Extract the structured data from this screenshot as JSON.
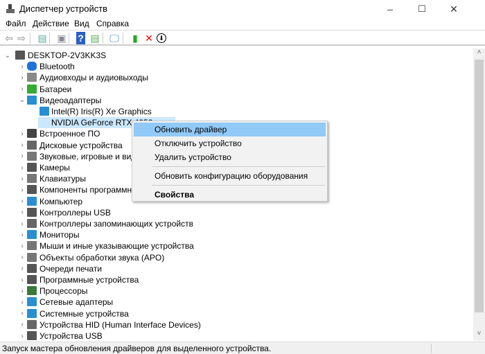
{
  "window": {
    "title": "Диспетчер устройств",
    "min": "–",
    "max": "☐",
    "close": "✕"
  },
  "menu": [
    "Файл",
    "Действие",
    "Вид",
    "Справка"
  ],
  "toolbar": [
    {
      "name": "back-icon",
      "glyph": "⇦",
      "color": "#888"
    },
    {
      "name": "forward-icon",
      "glyph": "⇨",
      "color": "#888"
    },
    {
      "name": "show-hide-console-icon",
      "glyph": "▤",
      "color": "#5a9"
    },
    {
      "name": "properties-icon",
      "glyph": "▣",
      "color": "#889"
    },
    {
      "name": "help-icon",
      "glyph": "?",
      "color": "#fff"
    },
    {
      "name": "action-pane-icon",
      "glyph": "▤",
      "color": "#5a5"
    },
    {
      "name": "scan-hardware-icon",
      "glyph": "🖵",
      "color": "#2a8fd0"
    },
    {
      "name": "update-driver-icon",
      "glyph": "▮",
      "color": "#2a2"
    },
    {
      "name": "uninstall-icon",
      "glyph": "✕",
      "color": "#e00"
    },
    {
      "name": "disable-icon",
      "glyph": "⬇",
      "color": "#000"
    }
  ],
  "tree": [
    {
      "label": "DESKTOP-2V3KK3S",
      "level": 0,
      "chev": "⌄",
      "icon": "computer-icon",
      "color": "#555"
    },
    {
      "label": "Bluetooth",
      "level": 1,
      "chev": "›",
      "icon": "bluetooth-icon",
      "color": "#1e73d8"
    },
    {
      "label": "Аудиовходы и аудиовыходы",
      "level": 1,
      "chev": "›",
      "icon": "speaker-icon",
      "color": "#888"
    },
    {
      "label": "Батареи",
      "level": 1,
      "chev": "›",
      "icon": "battery-icon",
      "color": "#3a3"
    },
    {
      "label": "Видеоадаптеры",
      "level": 1,
      "chev": "⌄",
      "icon": "display-adapter-icon",
      "color": "#2a8fd0"
    },
    {
      "label": "Intel(R) Iris(R) Xe Graphics",
      "level": 2,
      "chev": "",
      "icon": "display-adapter-icon",
      "color": "#2a8fd0"
    },
    {
      "label": "NVIDIA GeForce RTX 4050",
      "level": 2,
      "chev": "",
      "icon": "display-adapter-icon",
      "color": "#2a8fd0",
      "selected": true
    },
    {
      "label": "Встроенное ПО",
      "level": 1,
      "chev": "›",
      "icon": "firmware-icon",
      "color": "#444"
    },
    {
      "label": "Дисковые устройства",
      "level": 1,
      "chev": "›",
      "icon": "disk-icon",
      "color": "#666"
    },
    {
      "label": "Звуковые, игровые и видеоустройства",
      "level": 1,
      "chev": "›",
      "icon": "sound-icon",
      "color": "#777"
    },
    {
      "label": "Камеры",
      "level": 1,
      "chev": "›",
      "icon": "camera-icon",
      "color": "#555"
    },
    {
      "label": "Клавиатуры",
      "level": 1,
      "chev": "›",
      "icon": "keyboard-icon",
      "color": "#777"
    },
    {
      "label": "Компоненты программного обеспечения",
      "level": 1,
      "chev": "›",
      "icon": "software-component-icon",
      "color": "#555"
    },
    {
      "label": "Компьютер",
      "level": 1,
      "chev": "›",
      "icon": "monitor-icon",
      "color": "#2a8fd0"
    },
    {
      "label": "Контроллеры USB",
      "level": 1,
      "chev": "›",
      "icon": "usb-icon",
      "color": "#555"
    },
    {
      "label": "Контроллеры запоминающих устройств",
      "level": 1,
      "chev": "›",
      "icon": "storage-controller-icon",
      "color": "#666"
    },
    {
      "label": "Мониторы",
      "level": 1,
      "chev": "›",
      "icon": "monitor-icon",
      "color": "#2a8fd0"
    },
    {
      "label": "Мыши и иные указывающие устройства",
      "level": 1,
      "chev": "›",
      "icon": "mouse-icon",
      "color": "#777"
    },
    {
      "label": "Объекты обработки звука (APO)",
      "level": 1,
      "chev": "›",
      "icon": "audio-processing-icon",
      "color": "#777"
    },
    {
      "label": "Очереди печати",
      "level": 1,
      "chev": "›",
      "icon": "printer-icon",
      "color": "#555"
    },
    {
      "label": "Программные устройства",
      "level": 1,
      "chev": "›",
      "icon": "software-device-icon",
      "color": "#555"
    },
    {
      "label": "Процессоры",
      "level": 1,
      "chev": "›",
      "icon": "processor-icon",
      "color": "#3a7a3a"
    },
    {
      "label": "Сетевые адаптеры",
      "level": 1,
      "chev": "›",
      "icon": "network-adapter-icon",
      "color": "#2a8fd0"
    },
    {
      "label": "Системные устройства",
      "level": 1,
      "chev": "›",
      "icon": "system-device-icon",
      "color": "#2a8fd0"
    },
    {
      "label": "Устройства HID (Human Interface Devices)",
      "level": 1,
      "chev": "›",
      "icon": "hid-icon",
      "color": "#666"
    },
    {
      "label": "Устройства USB",
      "level": 1,
      "chev": "›",
      "icon": "usb-icon",
      "color": "#555"
    }
  ],
  "context_menu": [
    {
      "label": "Обновить драйвер",
      "highlighted": true
    },
    {
      "label": "Отключить устройство"
    },
    {
      "label": "Удалить устройство"
    },
    {
      "separator": true
    },
    {
      "label": "Обновить конфигурацию оборудования"
    },
    {
      "separator": true
    },
    {
      "label": "Свойства",
      "bold": true
    }
  ],
  "scrollbar": {
    "up": "˄",
    "down": "˅"
  },
  "status": "Запуск мастера обновления драйверов для выделенного устройства."
}
